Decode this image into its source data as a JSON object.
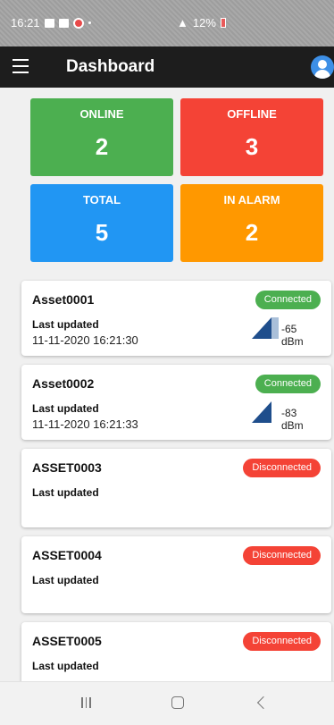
{
  "status_bar": {
    "time": "16:21",
    "battery": "12%"
  },
  "app_bar": {
    "title": "Dashboard"
  },
  "tiles": {
    "online": {
      "label": "ONLINE",
      "value": "2",
      "color": "#4caf50"
    },
    "offline": {
      "label": "OFFLINE",
      "value": "3",
      "color": "#f44336"
    },
    "total": {
      "label": "TOTAL",
      "value": "5",
      "color": "#2196f3"
    },
    "in_alarm": {
      "label": "IN ALARM",
      "value": "2",
      "color": "#ff9800"
    }
  },
  "assets": [
    {
      "name": "Asset0001",
      "status": "Connected",
      "last_updated_label": "Last updated",
      "last_updated": "11-11-2020 16:21:30",
      "signal": "-65 dBm"
    },
    {
      "name": "Asset0002",
      "status": "Connected",
      "last_updated_label": "Last updated",
      "last_updated": "11-11-2020 16:21:33",
      "signal": "-83 dBm"
    },
    {
      "name": "ASSET0003",
      "status": "Disconnected",
      "last_updated_label": "Last updated"
    },
    {
      "name": "ASSET0004",
      "status": "Disconnected",
      "last_updated_label": "Last updated"
    },
    {
      "name": "ASSET0005",
      "status": "Disconnected",
      "last_updated_label": "Last updated"
    }
  ],
  "colors": {
    "connected": "#4caf50",
    "disconnected": "#f44336",
    "app_bar": "#1d1d1d",
    "signal": "#1f4e8c"
  }
}
